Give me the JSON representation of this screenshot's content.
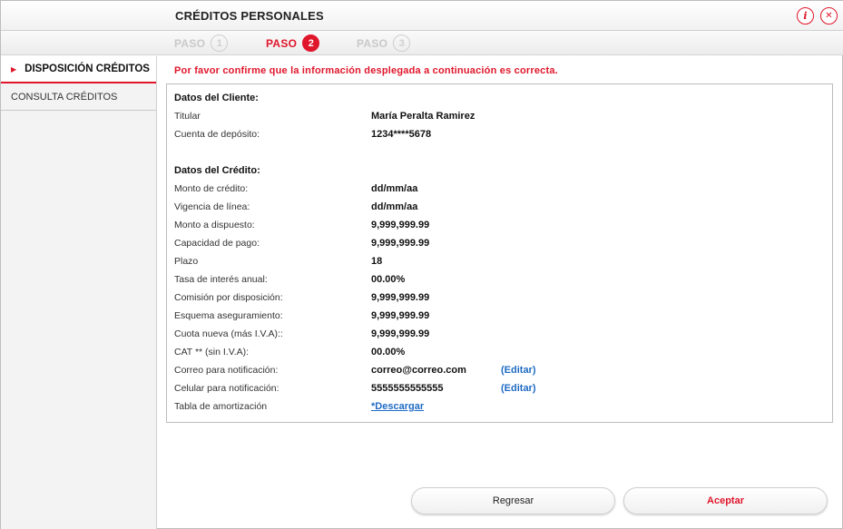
{
  "header": {
    "title": "CRÉDITOS PERSONALES",
    "info_icon": "i",
    "collapse_icon": "✕"
  },
  "steps": [
    {
      "label": "PASO",
      "number": "1",
      "active": false
    },
    {
      "label": "PASO",
      "number": "2",
      "active": true
    },
    {
      "label": "PASO",
      "number": "3",
      "active": false
    }
  ],
  "sidebar": {
    "items": [
      {
        "label": "DISPOSICIÓN CRÉDITOS",
        "active": true
      },
      {
        "label": "CONSULTA CRÉDITOS",
        "active": false
      }
    ]
  },
  "notice": "Por favor confirme que la información desplegada a continuación es correcta.",
  "cliente": {
    "title": "Datos del Cliente:",
    "rows": [
      {
        "label": "Titular",
        "value": "María Peralta Ramirez"
      },
      {
        "label": "Cuenta de depósito:",
        "value": "1234****5678"
      }
    ]
  },
  "credito": {
    "title": "Datos del Crédito:",
    "rows": [
      {
        "label": "Monto de crédito:",
        "value": "dd/mm/aa"
      },
      {
        "label": "Vigencia de línea:",
        "value": "dd/mm/aa"
      },
      {
        "label": "Monto a dispuesto:",
        "value": "9,999,999.99"
      },
      {
        "label": "Capacidad de pago:",
        "value": "9,999,999.99"
      },
      {
        "label": "Plazo",
        "value": "18"
      },
      {
        "label": "Tasa de interés anual:",
        "value": "00.00%"
      },
      {
        "label": "Comisión por disposición:",
        "value": "9,999,999.99"
      },
      {
        "label": "Esquema aseguramiento:",
        "value": "9,999,999.99"
      },
      {
        "label": "Cuota nueva (más I.V.A)::",
        "value": "9,999,999.99"
      },
      {
        "label": "CAT ** (sin I.V.A):",
        "value": "00.00%"
      },
      {
        "label": "Correo para notificación:",
        "value": "correo@correo.com",
        "action": "(Editar)"
      },
      {
        "label": "Celular para notificación:",
        "value": "5555555555555",
        "action": "(Editar)"
      },
      {
        "label": "Tabla de amortización",
        "link": "*Descargar"
      }
    ]
  },
  "buttons": {
    "back": "Regresar",
    "accept": "Aceptar"
  },
  "colors": {
    "accent": "#e0162b",
    "link": "#1f6bc4"
  }
}
